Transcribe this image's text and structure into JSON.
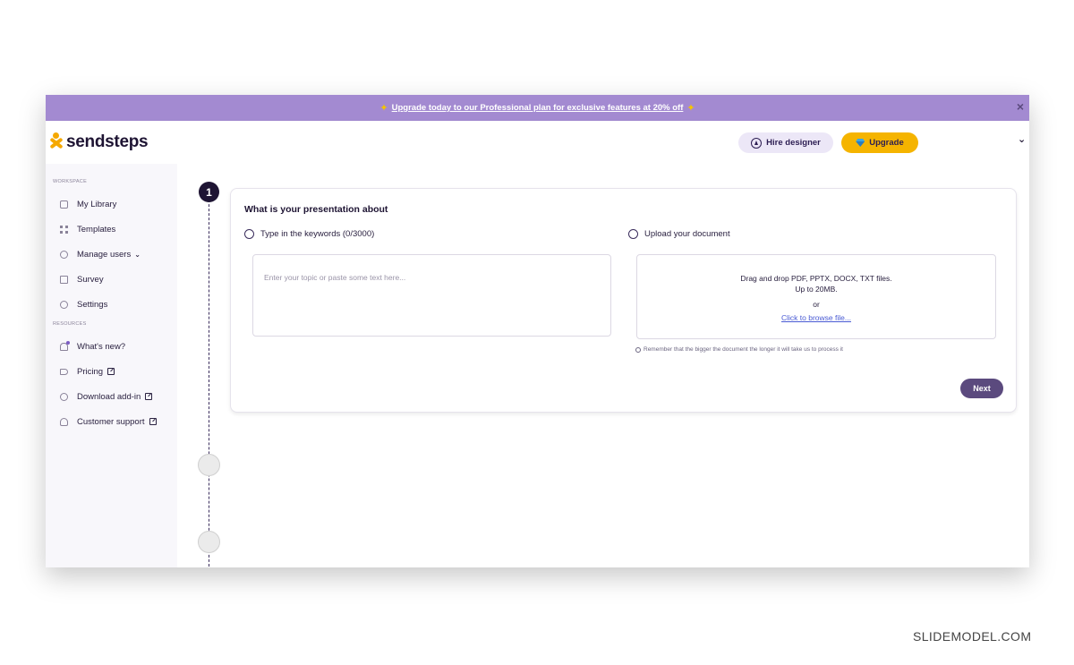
{
  "promo": {
    "text": "Upgrade today to our Professional plan for exclusive features at 20% off",
    "sparkle": "✦",
    "close": "×"
  },
  "header": {
    "logo_text": "sendsteps",
    "hire_label": "Hire designer",
    "upgrade_label": "Upgrade",
    "menu_chevron": "⌄"
  },
  "sidebar": {
    "workspace_heading": "WORKSPACE",
    "resources_heading": "RESOURCES",
    "items": [
      {
        "label": "My Library",
        "icon": "home-icon"
      },
      {
        "label": "Templates",
        "icon": "grid-icon"
      },
      {
        "label": "Manage users",
        "icon": "users-icon",
        "caret": "⌄"
      },
      {
        "label": "Survey",
        "icon": "clipboard-icon"
      },
      {
        "label": "Settings",
        "icon": "gear-icon"
      }
    ],
    "resources": [
      {
        "label": "What's new?",
        "icon": "bell-icon"
      },
      {
        "label": "Pricing",
        "icon": "tag-icon"
      },
      {
        "label": "Download add-in",
        "icon": "share-icon"
      },
      {
        "label": "Customer support",
        "icon": "headset-icon"
      }
    ]
  },
  "wizard": {
    "active_step": "1",
    "card_title": "What is your presentation about",
    "option_keywords": "Type in the keywords (0/3000)",
    "option_upload": "Upload your document",
    "textarea_placeholder": "Enter your topic or paste some text here...",
    "dropzone_line1": "Drag and drop PDF, PPTX, DOCX, TXT files.",
    "dropzone_line2": "Up to 20MB.",
    "dropzone_or": "or",
    "dropzone_link": "Click to browse file...",
    "note": "Remember that the bigger the document the longer it will take us to process it",
    "next_label": "Next"
  },
  "watermark": "SLIDEMODEL.COM",
  "colors": {
    "promo_bg": "#a38ad1",
    "upgrade_bg": "#f5b400",
    "next_bg": "#5b4a7e",
    "step_active": "#1e1433",
    "link": "#4a5bd4"
  }
}
